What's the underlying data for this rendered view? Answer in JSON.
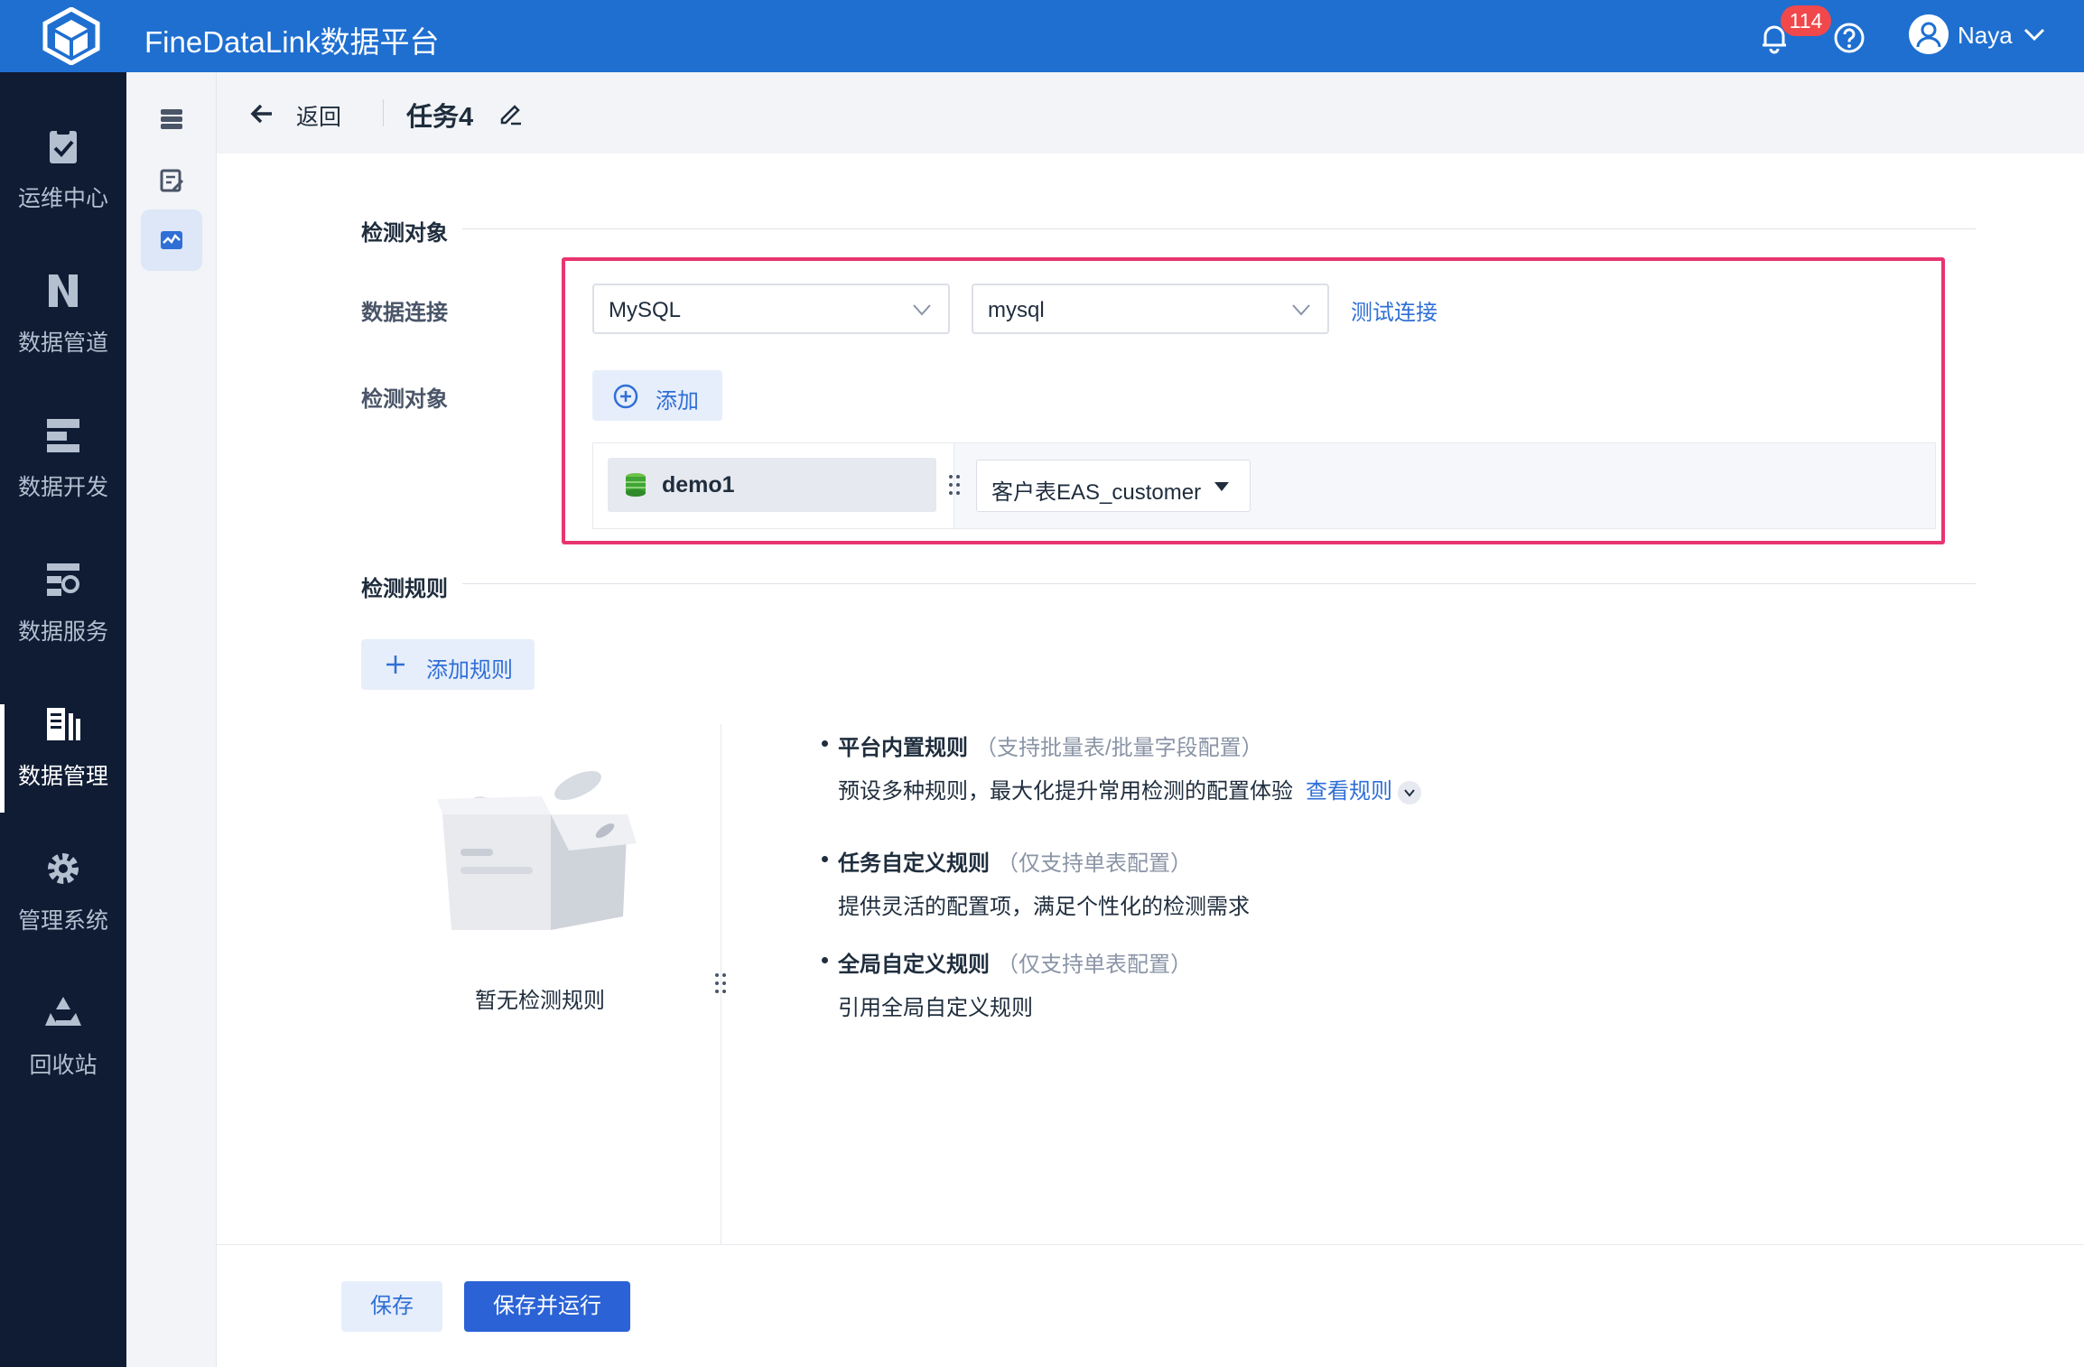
{
  "app": {
    "title": "FineDataLink数据平台"
  },
  "topbar": {
    "notifications": "114",
    "user": "Naya"
  },
  "nav": {
    "items": [
      {
        "label": "运维中心",
        "icon": "clipboard-check-icon"
      },
      {
        "label": "数据管道",
        "icon": "pipeline-icon"
      },
      {
        "label": "数据开发",
        "icon": "develop-icon"
      },
      {
        "label": "数据服务",
        "icon": "service-icon"
      },
      {
        "label": "数据管理",
        "icon": "manage-icon",
        "active": true
      },
      {
        "label": "管理系统",
        "icon": "gear-icon"
      },
      {
        "label": "回收站",
        "icon": "recycle-icon"
      }
    ]
  },
  "header": {
    "back": "返回",
    "task": "任务4"
  },
  "detect_object": {
    "section": "检测对象",
    "conn_label": "数据连接",
    "db_type": "MySQL",
    "conn_name": "mysql",
    "test_link": "测试连接",
    "obj_label": "检测对象",
    "add": "添加",
    "db": "demo1",
    "table": "客户表EAS_customer"
  },
  "rules": {
    "section": "检测规则",
    "add_rule": "添加规则",
    "empty": "暂无检测规则",
    "items": [
      {
        "name": "平台内置规则",
        "note": "（支持批量表/批量字段配置）",
        "desc": "预设多种规则，最大化提升常用检测的配置体验",
        "link": "查看规则"
      },
      {
        "name": "任务自定义规则",
        "note": "（仅支持单表配置）",
        "desc": "提供灵活的配置项，满足个性化的检测需求"
      },
      {
        "name": "全局自定义规则",
        "note": "（仅支持单表配置）",
        "desc": "引用全局自定义规则"
      }
    ]
  },
  "footer": {
    "save": "保存",
    "save_run": "保存并运行"
  },
  "colors": {
    "brand": "#1f6fd0",
    "sidebar": "#0f1c34",
    "accent": "#2f6fd6",
    "highlight": "#e8356f"
  }
}
